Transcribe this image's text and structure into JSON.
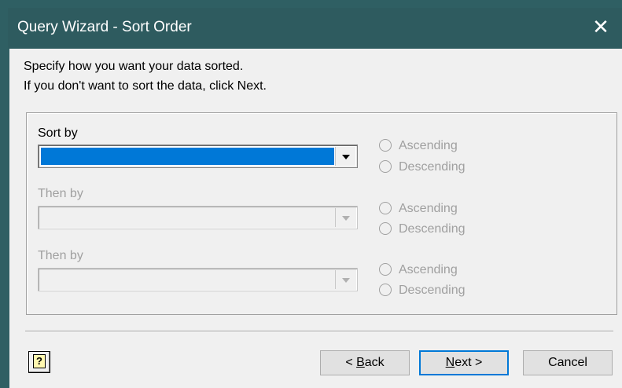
{
  "window": {
    "title": "Query Wizard - Sort Order",
    "close_glyph": "✕"
  },
  "intro": {
    "line1": "Specify how you want your data sorted.",
    "line2": "If you don't want to sort the data, click Next."
  },
  "sort_groups": [
    {
      "label": "Sort by",
      "enabled": true,
      "selected_value": "",
      "ascending_label": "Ascending",
      "descending_label": "Descending"
    },
    {
      "label": "Then by",
      "enabled": false,
      "selected_value": "",
      "ascending_label": "Ascending",
      "descending_label": "Descending"
    },
    {
      "label": "Then by",
      "enabled": false,
      "selected_value": "",
      "ascending_label": "Ascending",
      "descending_label": "Descending"
    }
  ],
  "buttons": {
    "help_glyph": "?",
    "back_prefix": "< ",
    "back_mnemonic": "B",
    "back_rest": "ack",
    "next_mnemonic": "N",
    "next_rest": "ext >",
    "cancel": "Cancel"
  },
  "colors": {
    "titlebar": "#2e5b5f",
    "selection": "#0078d7",
    "dialog_bg": "#f0f0f0"
  }
}
